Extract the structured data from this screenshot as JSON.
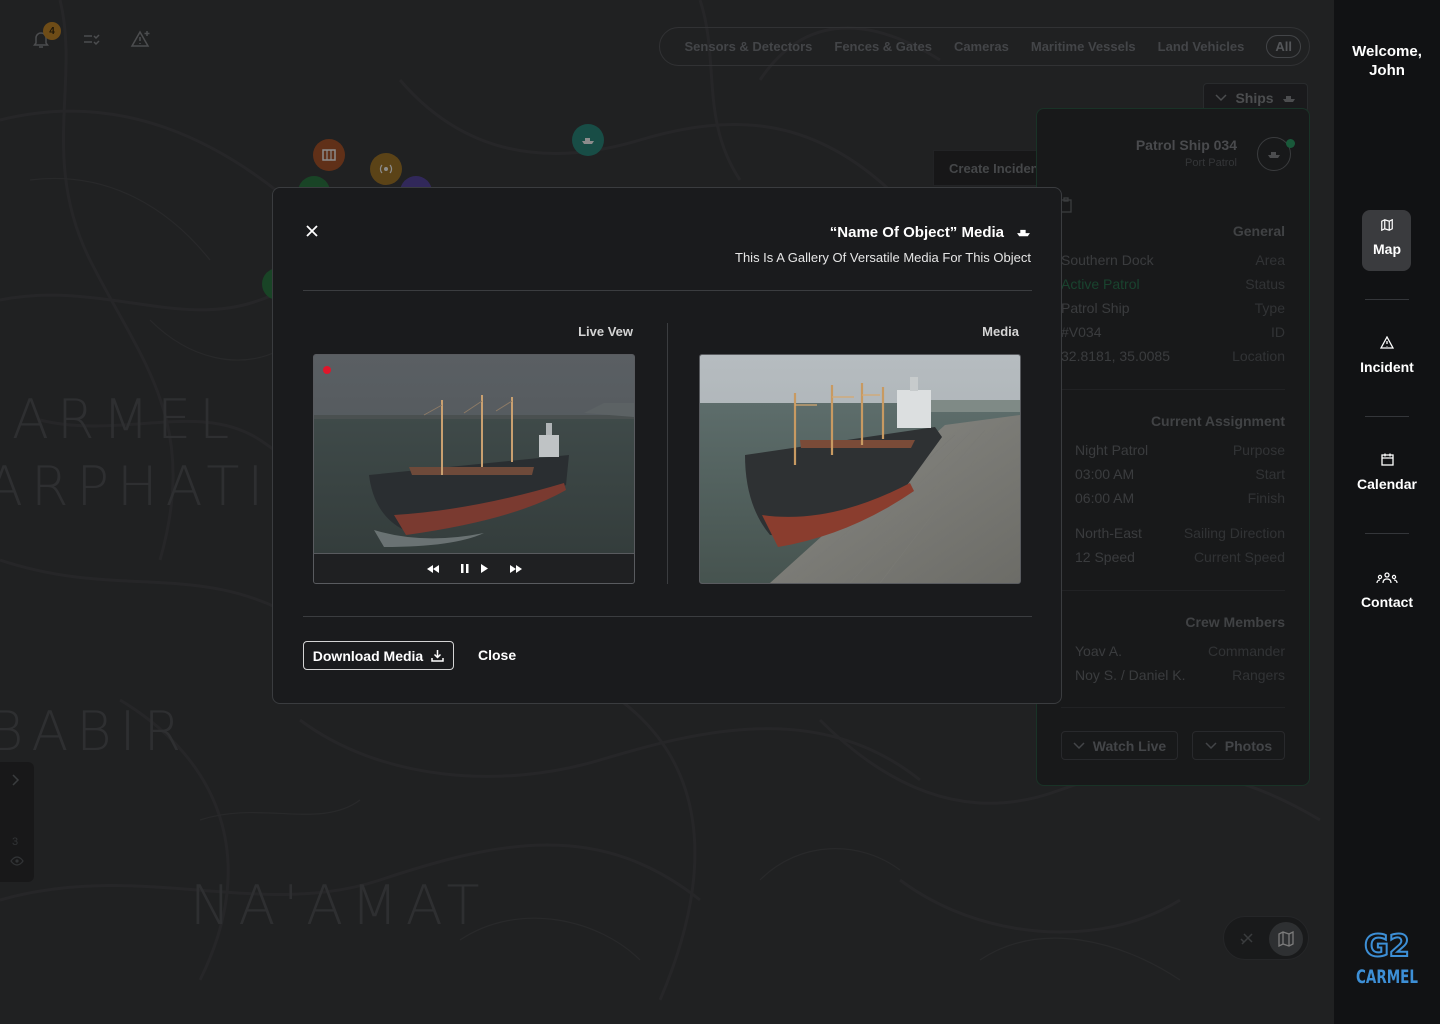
{
  "map": {
    "labels": [
      "ARMEL",
      "ARPHATI",
      "BABIR",
      "NA'AMAT"
    ],
    "notification_count": "4"
  },
  "filters": {
    "items": [
      "Sensors & Detectors",
      "Fences & Gates",
      "Cameras",
      "Maritime Vessels",
      "Land Vehicles",
      "All"
    ]
  },
  "ships_dropdown": {
    "label": "Ships"
  },
  "create_incident": {
    "label": "Create Incident"
  },
  "info_panel": {
    "name": "Patrol Ship 034",
    "sub": "Port Patrol",
    "general": {
      "title": "General",
      "rows": [
        {
          "value": "Southern Dock",
          "key": "Area"
        },
        {
          "value": "Active Patrol",
          "key": "Status"
        },
        {
          "value": "Patrol Ship",
          "key": "Type"
        },
        {
          "value": "#V034",
          "key": "ID"
        },
        {
          "value": "32.8181, 35.0085",
          "key": "Location"
        }
      ]
    },
    "assignment": {
      "title": "Current Assignment",
      "rows": [
        {
          "value": "Night Patrol",
          "key": "Purpose"
        },
        {
          "value": "03:00 AM",
          "key": "Start"
        },
        {
          "value": "06:00 AM",
          "key": "Finish"
        },
        {
          "value": "North-East",
          "key": "Sailing Direction"
        },
        {
          "value": "12 Speed",
          "key": "Current Speed"
        }
      ]
    },
    "crew": {
      "title": "Crew Members",
      "rows": [
        {
          "value": "Yoav A.",
          "key": "Commander"
        },
        {
          "value": "Noy S. / Daniel K.",
          "key": "Rangers"
        }
      ]
    },
    "watch_live": "Watch Live",
    "photos": "Photos"
  },
  "left_tab": {
    "count": "3"
  },
  "sidebar": {
    "welcome": "Welcome,\nJohn",
    "items": [
      {
        "label": "Map"
      },
      {
        "label": "Incident"
      },
      {
        "label": "Calendar"
      },
      {
        "label": "Contact"
      }
    ],
    "logo_top": "G2",
    "logo_bottom": "CARMEL"
  },
  "modal": {
    "title": "“Name Of Object” Media",
    "subtitle": "This Is A Gallery Of Versatile Media For This Object",
    "live_label": "Live Vew",
    "media_label": "Media",
    "download_label": "Download Media",
    "close_label": "Close"
  },
  "colors": {
    "accent_green": "#2fa36b",
    "record_red": "#e0162b",
    "sidebar_bg": "#111214",
    "logo_blue": "#3d8fd6"
  }
}
